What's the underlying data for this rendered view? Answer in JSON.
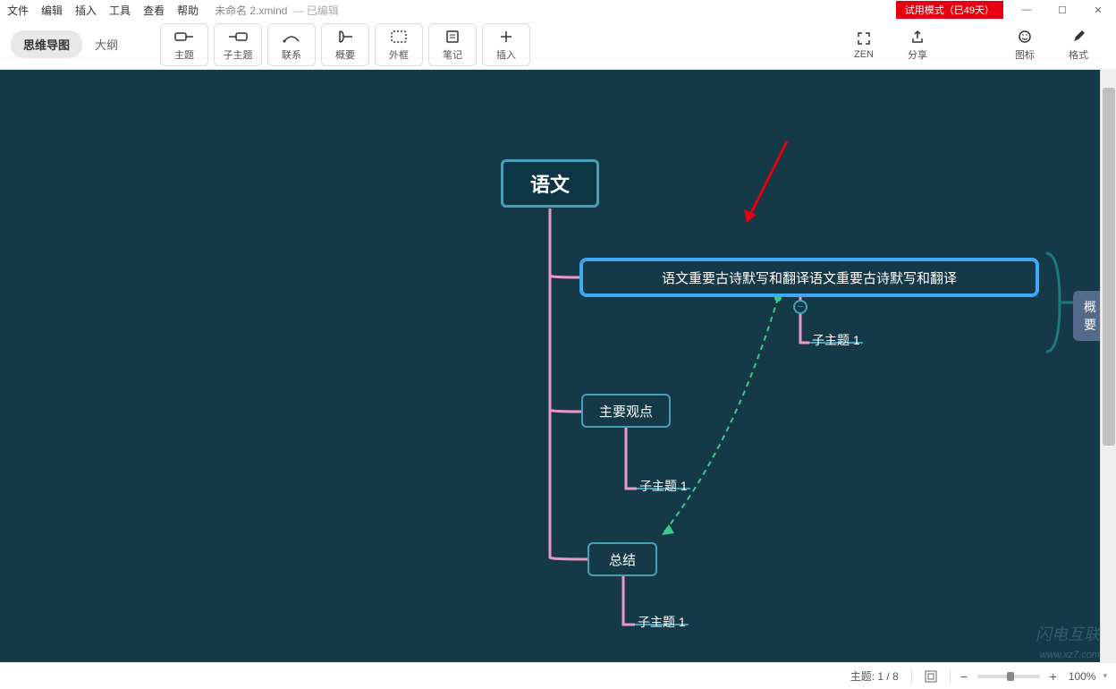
{
  "menu": {
    "file": "文件",
    "edit": "编辑",
    "insert": "插入",
    "tools": "工具",
    "view": "查看",
    "help": "帮助"
  },
  "title": {
    "filename": "未命名 2.xmind",
    "edited": "— 已编辑"
  },
  "trial_badge": "试用模式（已49天）",
  "window_controls": {
    "min": "—",
    "max": "☐",
    "close": "✕"
  },
  "view_tabs": {
    "mindmap": "思维导图",
    "outline": "大纲"
  },
  "toolbar": {
    "topic": {
      "label": "主题"
    },
    "subtopic": {
      "label": "子主题"
    },
    "relationship": {
      "label": "联系"
    },
    "summary": {
      "label": "概要"
    },
    "boundary": {
      "label": "外框"
    },
    "notes": {
      "label": "笔记"
    },
    "insert": {
      "label": "插入"
    },
    "zen": {
      "label": "ZEN"
    },
    "share": {
      "label": "分享"
    },
    "icons": {
      "label": "图标"
    },
    "format": {
      "label": "格式"
    }
  },
  "nodes": {
    "root": "语文",
    "branch1": "语文重要古诗默写和翻译语文重要古诗默写和翻译",
    "branch1_sub": "子主题 1",
    "branch2": "主要观点",
    "branch2_sub": "子主题 1",
    "branch3": "总结",
    "branch3_sub": "子主题 1",
    "summary": "概要"
  },
  "status": {
    "topic_label": "主题:",
    "topic_count": "1 / 8",
    "zoom": "100%"
  }
}
